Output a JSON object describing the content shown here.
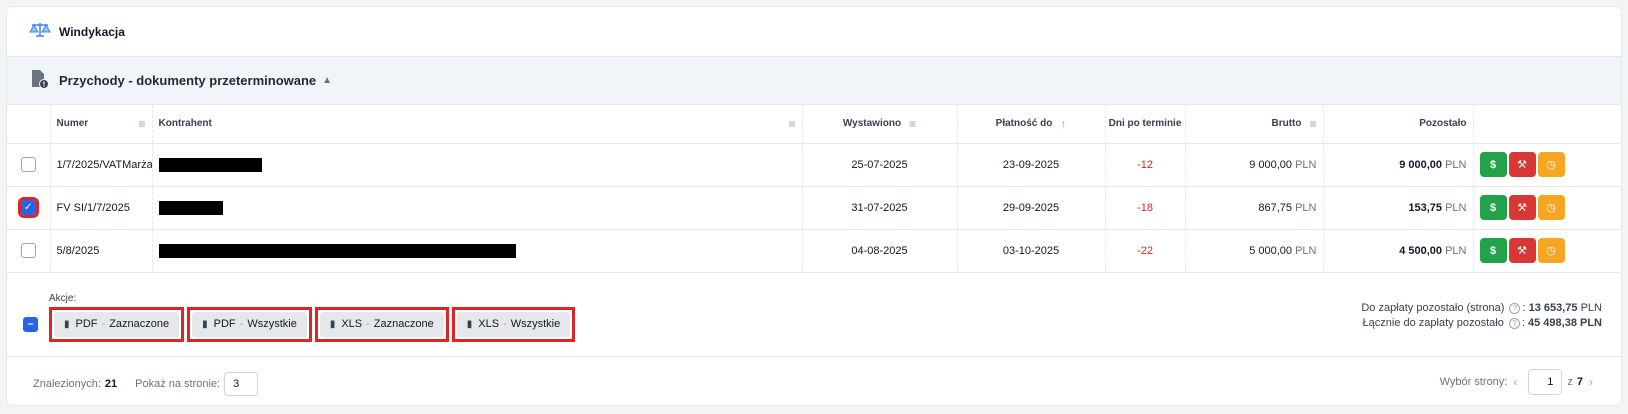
{
  "header": {
    "title": "Windykacja",
    "icon": "scales-icon"
  },
  "section": {
    "title": "Przychody - dokumenty przeterminowane",
    "icon": "document-alert-icon"
  },
  "table": {
    "columns": {
      "numer": "Numer",
      "kontrahent": "Kontrahent",
      "wystawiono": "Wystawiono",
      "platnosc": "Płatność do",
      "dni": "Dni po terminie",
      "brutto": "Brutto",
      "pozostalo": "Pozostało"
    },
    "rows": [
      {
        "numer": "1/7/2025/VATMarża",
        "wystawiono": "25-07-2025",
        "platnosc": "23-09-2025",
        "dni": "-12",
        "brutto": "9 000,00",
        "pozostalo": "9 000,00",
        "currency": "PLN",
        "checked": false
      },
      {
        "numer": "FV SI/1/7/2025",
        "wystawiono": "31-07-2025",
        "platnosc": "29-09-2025",
        "dni": "-18",
        "brutto": "867,75",
        "pozostalo": "153,75",
        "currency": "PLN",
        "checked": true
      },
      {
        "numer": "5/8/2025",
        "wystawiono": "04-08-2025",
        "platnosc": "03-10-2025",
        "dni": "-22",
        "brutto": "5 000,00",
        "pozostalo": "4 500,00",
        "currency": "PLN",
        "checked": false
      }
    ],
    "row_actions": {
      "pay": "$",
      "hammer": "⚒",
      "clock": "◷"
    }
  },
  "actions": {
    "label": "Akcje:",
    "select_all_symbol": "–",
    "buttons": [
      {
        "type": "PDF",
        "scope": "Zaznaczone"
      },
      {
        "type": "PDF",
        "scope": "Wszystkie"
      },
      {
        "type": "XLS",
        "scope": "Zaznaczone"
      },
      {
        "type": "XLS",
        "scope": "Wszystkie"
      }
    ],
    "separator": "-"
  },
  "summary": {
    "page_label": "Do zapłaty pozostało (strona)",
    "page_value": "13 653,75",
    "total_label": "Łącznie do zapłaty pozostało",
    "total_value": "45 498,38",
    "currency": "PLN"
  },
  "footer": {
    "found_label": "Znalezionych:",
    "found_value": "21",
    "per_page_label": "Pokaż na stronie:",
    "per_page_value": "3",
    "page_select_label": "Wybór strony:",
    "current_page": "1",
    "of_label": "z",
    "total_pages": "7"
  },
  "colors": {
    "accent": "#2563eb",
    "highlight": "#dc2626",
    "pay": "#22a34a",
    "hammer": "#d93636",
    "clock": "#f5a623"
  }
}
